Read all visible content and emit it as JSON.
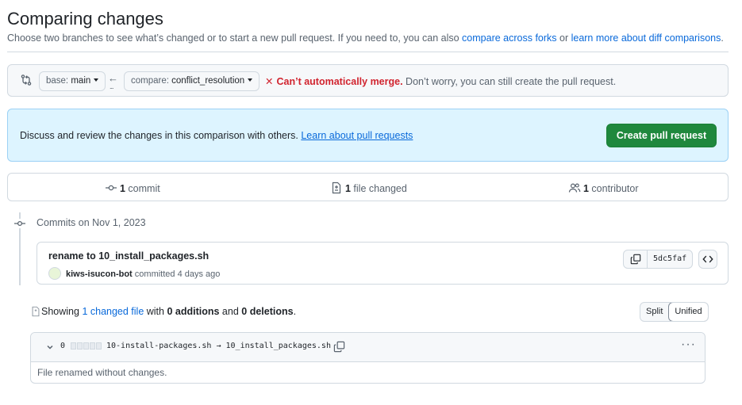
{
  "page": {
    "title": "Comparing changes",
    "subtitle_prefix": "Choose two branches to see what’s changed or to start a new pull request. If you need to, you can also ",
    "link_compare_forks": "compare across forks",
    "subtitle_or": " or ",
    "link_learn_diff": "learn more about diff comparisons",
    "subtitle_suffix": "."
  },
  "range": {
    "icon": "git-compare-icon",
    "base_label": "base:",
    "base_value": "main",
    "compare_label": "compare:",
    "compare_value": "conflict_resolution",
    "arrow_icon": "arrow-left-icon",
    "arrow_dots": "...",
    "status_icon": "x-icon",
    "status_bad": "Can’t automatically merge.",
    "status_note": " Don’t worry, you can still create the pull request."
  },
  "discuss": {
    "text": "Discuss and review the changes in this comparison with others. ",
    "link": "Learn about pull requests",
    "button": "Create pull request"
  },
  "stats": {
    "commits_count": "1",
    "commits_label": " commit",
    "files_count": "1",
    "files_label": " file changed",
    "contributors_count": "1",
    "contributors_label": " contributor"
  },
  "timeline": {
    "date_heading": "Commits on Nov 1, 2023",
    "commit": {
      "message": "rename to 10_install_packages.sh",
      "author": "kiws-isucon-bot",
      "action": " committed ",
      "time": "4 days ago",
      "sha": "5dc5faf"
    }
  },
  "diff_summary": {
    "prefix": "Showing ",
    "link": "1 changed file",
    "middle": " with ",
    "additions": "0 additions",
    "and": " and ",
    "deletions": "0 deletions",
    "suffix": ".",
    "split_label": "Split",
    "unified_label": "Unified",
    "selected_view": "Unified"
  },
  "file": {
    "changes_count": "0",
    "path": "10-install-packages.sh → 10_install_packages.sh",
    "body": "File renamed without changes."
  },
  "colors": {
    "link": "#0969da",
    "danger": "#d1242f",
    "primary_button": "#1f883d",
    "info_bg": "#ddf4ff"
  }
}
